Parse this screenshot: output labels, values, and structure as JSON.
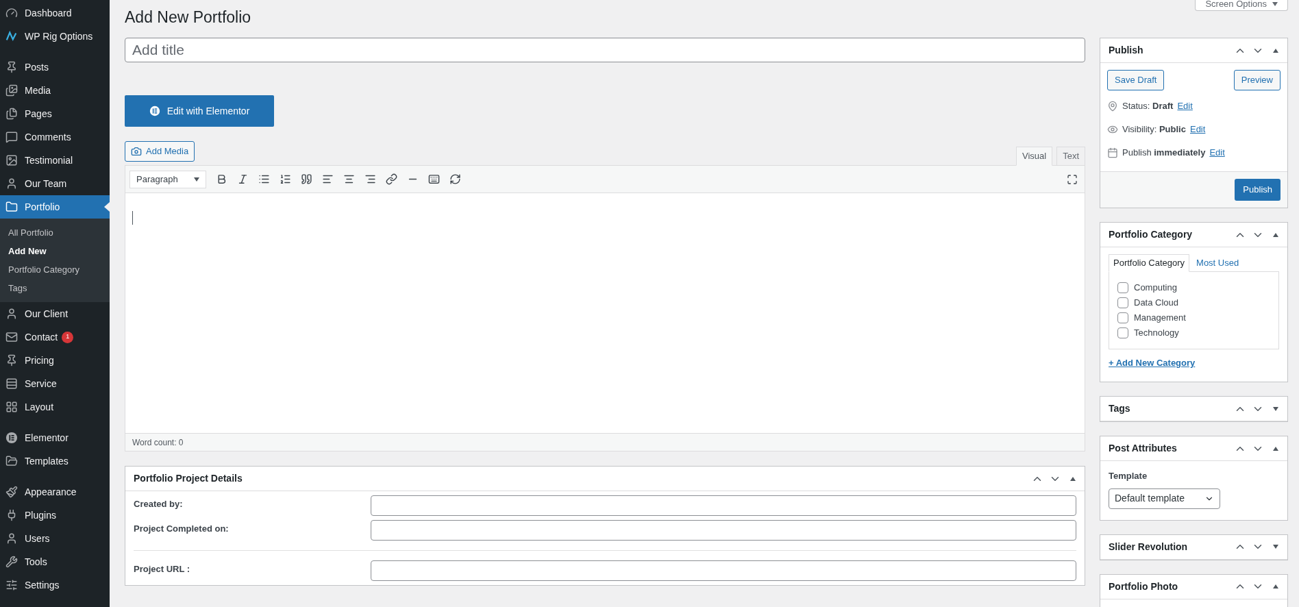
{
  "sidebar": {
    "groups": [
      {
        "items": [
          {
            "label": "Dashboard",
            "selected": false
          },
          {
            "label": "WP Rig Options",
            "selected": false
          }
        ]
      },
      {
        "items": [
          {
            "label": "Posts",
            "selected": false
          },
          {
            "label": "Media",
            "selected": false
          },
          {
            "label": "Pages",
            "selected": false
          },
          {
            "label": "Comments",
            "selected": false
          },
          {
            "label": "Testimonial",
            "selected": false
          },
          {
            "label": "Our Team",
            "selected": false
          },
          {
            "label": "Portfolio",
            "selected": true,
            "submenu": [
              {
                "label": "All Portfolio",
                "selected": false
              },
              {
                "label": "Add New",
                "selected": true
              },
              {
                "label": "Portfolio Category",
                "selected": false
              },
              {
                "label": "Tags",
                "selected": false
              }
            ]
          },
          {
            "label": "Our Client",
            "selected": false
          },
          {
            "label": "Contact",
            "selected": false,
            "badge": "1"
          },
          {
            "label": "Pricing",
            "selected": false
          },
          {
            "label": "Service",
            "selected": false
          },
          {
            "label": "Layout",
            "selected": false
          }
        ]
      },
      {
        "items": [
          {
            "label": "Elementor",
            "selected": false
          },
          {
            "label": "Templates",
            "selected": false
          }
        ]
      },
      {
        "items": [
          {
            "label": "Appearance",
            "selected": false
          },
          {
            "label": "Plugins",
            "selected": false
          },
          {
            "label": "Users",
            "selected": false
          },
          {
            "label": "Tools",
            "selected": false
          },
          {
            "label": "Settings",
            "selected": false
          }
        ]
      }
    ]
  },
  "page_title": "Add New Portfolio",
  "screen_options": "Screen Options",
  "title_field": {
    "placeholder": "Add title"
  },
  "elementor_button": "Edit with Elementor",
  "add_media": "Add Media",
  "editor": {
    "tabs": [
      {
        "label": "Visual",
        "selected": true
      },
      {
        "label": "Text",
        "selected": false
      }
    ],
    "format": "Paragraph",
    "word_count": "Word count: 0"
  },
  "project_details": {
    "title": "Portfolio Project Details",
    "expanded": true,
    "fields": [
      {
        "label": "Created by:"
      },
      {
        "label": "Project Completed on:"
      },
      {
        "label": "Project URL :"
      }
    ]
  },
  "side_boxes": [
    {
      "kind": "publish",
      "title": "Publish",
      "expanded": true,
      "save_draft": "Save Draft",
      "preview": "Preview",
      "rows": [
        {
          "text": "Status: **Draft**",
          "link": "Edit"
        },
        {
          "text": "Visibility: **Public**",
          "link": "Edit"
        },
        {
          "text": "Publish **immediately**",
          "link": "Edit"
        }
      ],
      "publish": "Publish"
    },
    {
      "kind": "category",
      "title": "Portfolio Category",
      "expanded": true,
      "tabs": [
        {
          "label": "Portfolio Category",
          "selected": true
        },
        {
          "label": "Most Used",
          "selected": false
        }
      ],
      "categories": [
        {
          "label": "Computing",
          "checked": false
        },
        {
          "label": "Data Cloud",
          "checked": false
        },
        {
          "label": "Management",
          "checked": false
        },
        {
          "label": "Technology",
          "checked": false
        }
      ],
      "add_link": "+ Add New Category"
    },
    {
      "kind": "plain",
      "title": "Tags",
      "expanded": false
    },
    {
      "kind": "attributes",
      "title": "Post Attributes",
      "expanded": true,
      "label": "Template",
      "value": "Default template"
    },
    {
      "kind": "plain",
      "title": "Slider Revolution",
      "expanded": false
    },
    {
      "kind": "plain",
      "title": "Portfolio Photo",
      "expanded": true
    }
  ]
}
